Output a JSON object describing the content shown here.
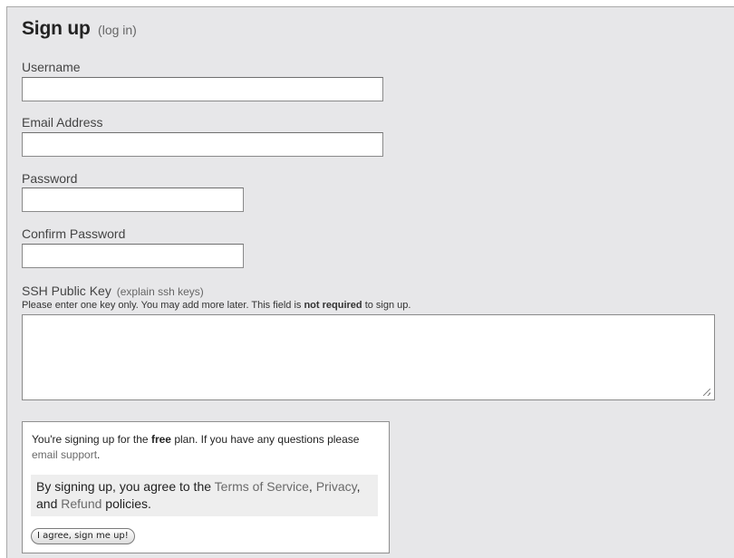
{
  "header": {
    "title": "Sign up",
    "login_link": "(log in)"
  },
  "fields": {
    "username": {
      "label": "Username",
      "value": ""
    },
    "email": {
      "label": "Email Address",
      "value": ""
    },
    "password": {
      "label": "Password",
      "value": ""
    },
    "confirm_password": {
      "label": "Confirm Password",
      "value": ""
    }
  },
  "ssh": {
    "label": "SSH Public Key",
    "explain_link": "(explain ssh keys)",
    "hint_before": "Please enter one key only. You may add more later. This field is",
    "hint_bold": "not required",
    "hint_after": "to sign up.",
    "value": ""
  },
  "plan": {
    "text_before": "You're signing up for the",
    "plan_name": "free",
    "text_after": "plan. If you have any questions please",
    "support_link": "email support",
    "support_after": "."
  },
  "agreement": {
    "text_before": "By signing up, you agree to the",
    "terms_link": "Terms of Service",
    "comma": ",",
    "privacy_link": "Privacy",
    "and_text": ", and",
    "refund_link": "Refund",
    "text_after": "policies."
  },
  "submit_label": "I agree, sign me up!"
}
